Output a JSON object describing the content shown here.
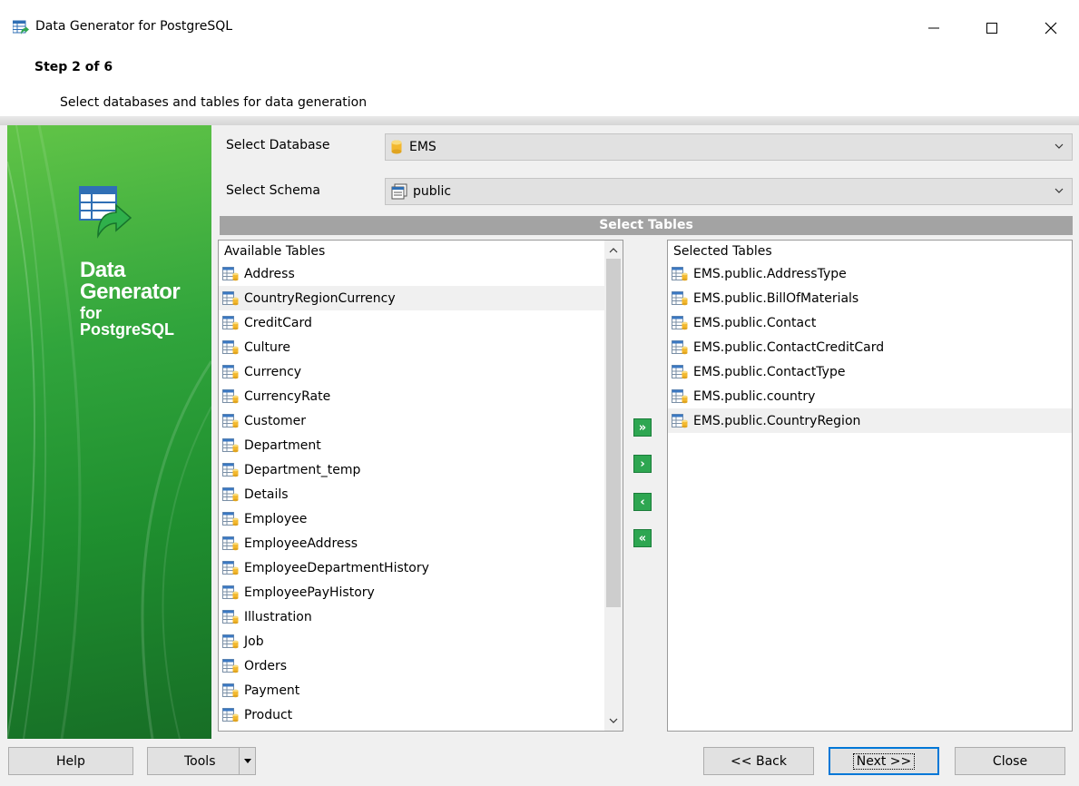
{
  "window": {
    "title": "Data Generator for PostgreSQL",
    "controls": {
      "minimize": "—",
      "maximize": "☐",
      "close": "✕"
    }
  },
  "header": {
    "step": "Step 2 of 6",
    "description": "Select databases and tables for data generation"
  },
  "sidebar": {
    "brand_line1": "Data",
    "brand_line2": "Generator",
    "brand_line3": "for",
    "brand_line4": "PostgreSQL"
  },
  "form": {
    "database_label": "Select Database",
    "database_value": "EMS",
    "schema_label": "Select Schema",
    "schema_value": "public",
    "tables_section": "Select Tables"
  },
  "available": {
    "header": "Available Tables",
    "items": [
      "Address",
      "CountryRegionCurrency",
      "CreditCard",
      "Culture",
      "Currency",
      "CurrencyRate",
      "Customer",
      "Department",
      "Department_temp",
      "Details",
      "Employee",
      "EmployeeAddress",
      "EmployeeDepartmentHistory",
      "EmployeePayHistory",
      "Illustration",
      "Job",
      "Orders",
      "Payment",
      "Product"
    ]
  },
  "selected": {
    "header": "Selected Tables",
    "items": [
      "EMS.public.AddressType",
      "EMS.public.BillOfMaterials",
      "EMS.public.Contact",
      "EMS.public.ContactCreditCard",
      "EMS.public.ContactType",
      "EMS.public.country",
      "EMS.public.CountryRegion"
    ]
  },
  "move_buttons": {
    "add_all": "»",
    "add": "›",
    "remove": "‹",
    "remove_all": "«"
  },
  "footer": {
    "help": "Help",
    "tools": "Tools",
    "back": "<< Back",
    "next": "Next >>",
    "close": "Close"
  },
  "colors": {
    "sidebar_green": "#31a53c",
    "move_button_green": "#2ea651",
    "section_bar": "#a3a3a3",
    "default_button_border": "#0078d7"
  }
}
